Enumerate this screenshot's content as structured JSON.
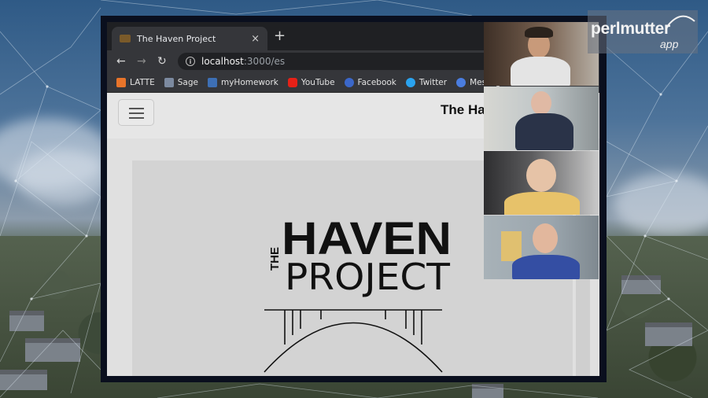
{
  "browser": {
    "tab_title": "The Haven Project",
    "tab_close": "×",
    "new_tab": "+",
    "url_host": "localhost",
    "url_path": ":3000/es",
    "back_icon": "←",
    "forward_icon": "→",
    "reload_icon": "↻",
    "info_icon": "i"
  },
  "bookmarks": [
    {
      "label": "LATTE",
      "icon": "latte-icon",
      "color": "#e8742a"
    },
    {
      "label": "Sage",
      "icon": "sage-icon",
      "color": "#7c8aa0"
    },
    {
      "label": "myHomework",
      "icon": "myhomework-icon",
      "color": "#3d6fb5"
    },
    {
      "label": "YouTube",
      "icon": "youtube-icon",
      "color": "#e62117"
    },
    {
      "label": "Facebook",
      "icon": "facebook-icon",
      "color": "#3b67c9"
    },
    {
      "label": "Twitter",
      "icon": "twitter-icon",
      "color": "#2aa3ef"
    },
    {
      "label": "Message",
      "icon": "message-icon",
      "color": "#4a7de0"
    }
  ],
  "page": {
    "site_title": "The Ha",
    "logo_the": "THE",
    "logo_haven": "HAVEN",
    "logo_project": "PROJECT"
  },
  "watermark": {
    "main": "perlmutter",
    "sub": "app"
  },
  "participants": [
    {
      "name": "participant-1",
      "bg": "#6a5546",
      "skin": "#c89a7a",
      "shirt": "#e4e4e4"
    },
    {
      "name": "participant-2",
      "bg": "#bfc6c8",
      "skin": "#e0b9a4",
      "shirt": "#2a3348"
    },
    {
      "name": "participant-3",
      "bg": "#4a4a4c",
      "skin": "#e6c3a7",
      "shirt": "#e7c26a"
    },
    {
      "name": "participant-4",
      "bg": "#9aa5ad",
      "skin": "#e2b79d",
      "shirt": "#344ea3"
    }
  ]
}
